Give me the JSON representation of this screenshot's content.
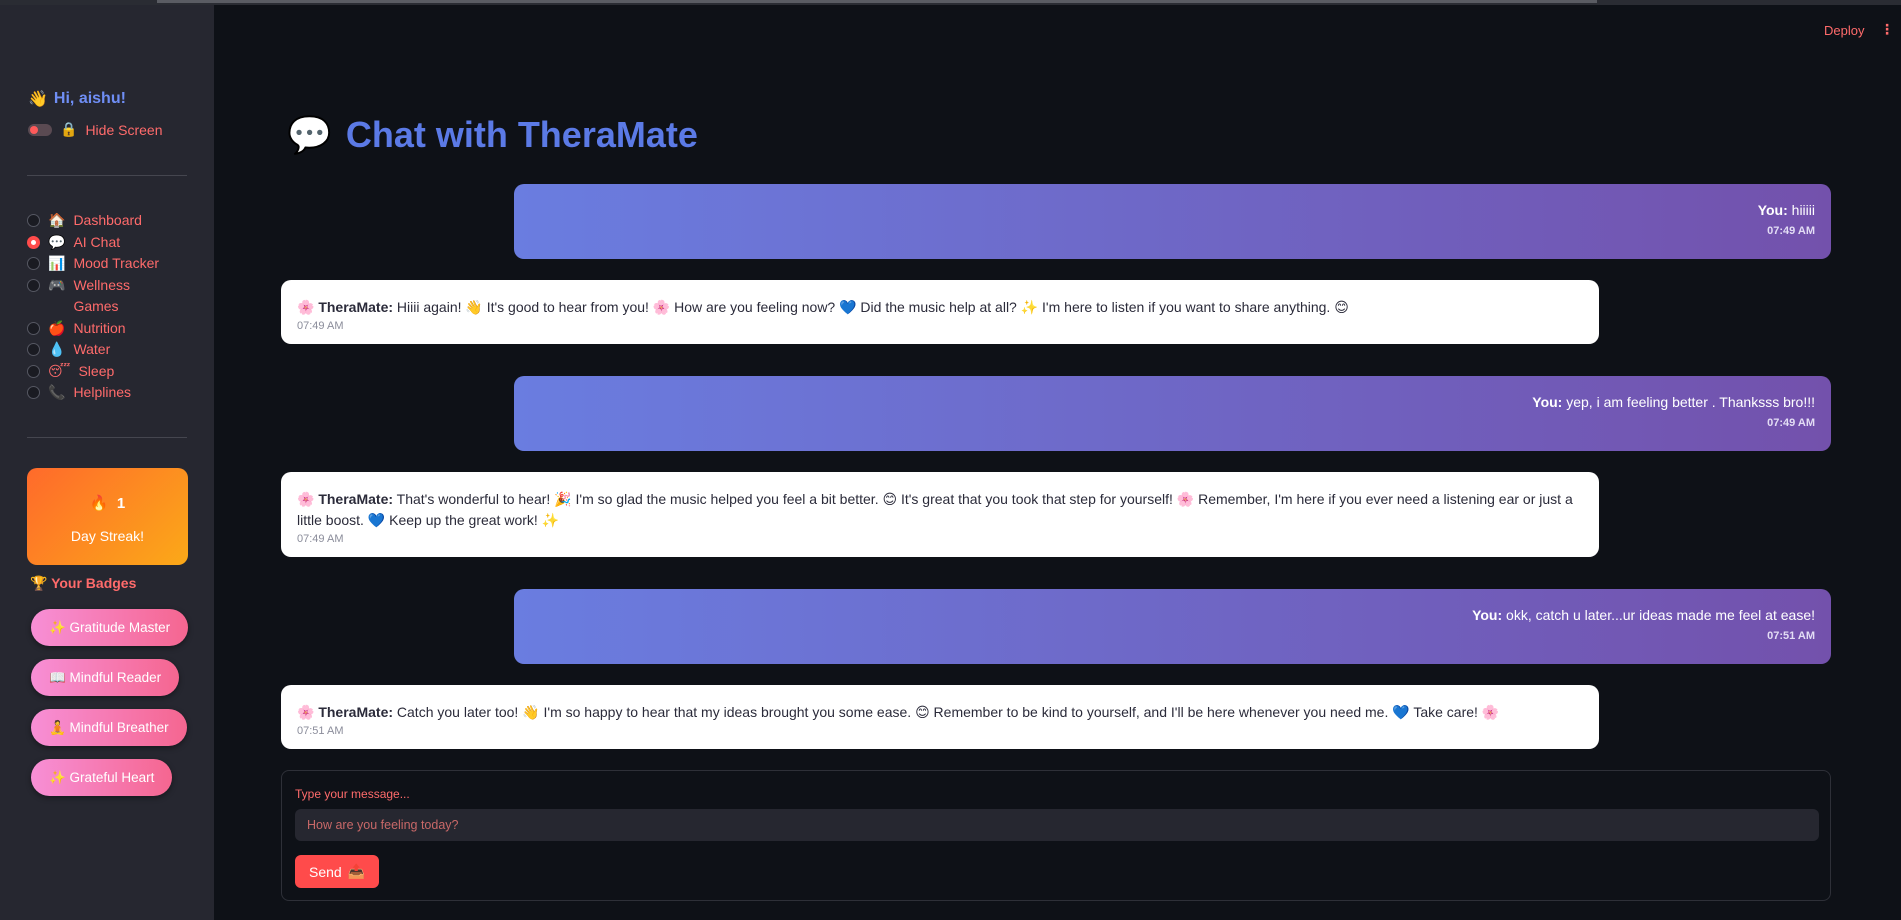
{
  "header": {
    "deploy_label": "Deploy",
    "menu_glyph": "⋮"
  },
  "sidebar": {
    "greeting_icon": "👋",
    "greeting": "Hi, aishu!",
    "hide_screen_icon": "🔒",
    "hide_screen_label": "Hide Screen",
    "nav": [
      {
        "icon": "🏠",
        "label": "Dashboard",
        "selected": false
      },
      {
        "icon": "💬",
        "label": "AI Chat",
        "selected": true
      },
      {
        "icon": "📊",
        "label": "Mood Tracker",
        "selected": false
      },
      {
        "icon": "🎮",
        "label": "Wellness Games",
        "selected": false
      },
      {
        "icon": "🍎",
        "label": "Nutrition",
        "selected": false
      },
      {
        "icon": "💧",
        "label": "Water",
        "selected": false
      },
      {
        "icon": "😴",
        "label": "Sleep",
        "selected": false
      },
      {
        "icon": "📞",
        "label": "Helplines",
        "selected": false
      }
    ],
    "streak": {
      "icon": "🔥",
      "count": "1",
      "label": "Day Streak!"
    },
    "badges_title": "🏆 Your Badges",
    "badges": [
      "✨ Gratitude Master",
      "📖 Mindful Reader",
      "🧘 Mindful Breather",
      "✨ Grateful Heart"
    ]
  },
  "main": {
    "title_icon": "💬",
    "title": "Chat with TheraMate",
    "messages": [
      {
        "role": "user",
        "speaker": "You:",
        "text": " hiiiii",
        "time": "07:49 AM"
      },
      {
        "role": "bot",
        "speaker": "TheraMate:",
        "text": " Hiiii again! 👋 It's good to hear from you! 🌸 How are you feeling now? 💙 Did the music help at all? ✨ I'm here to listen if you want to share anything. 😊",
        "time": "07:49 AM"
      },
      {
        "role": "user",
        "speaker": "You:",
        "text": " yep, i am feeling better . Thanksss bro!!!",
        "time": "07:49 AM"
      },
      {
        "role": "bot",
        "speaker": "TheraMate:",
        "text": " That's wonderful to hear! 🎉 I'm so glad the music helped you feel a bit better. 😊 It's great that you took that step for yourself! 🌸 Remember, I'm here if you ever need a listening ear or just a little boost. 💙 Keep up the great work! ✨",
        "time": "07:49 AM"
      },
      {
        "role": "user",
        "speaker": "You:",
        "text": " okk, catch u later...ur ideas made me feel at ease!",
        "time": "07:51 AM"
      },
      {
        "role": "bot",
        "speaker": "TheraMate:",
        "text": " Catch you later too! 👋 I'm so happy to hear that my ideas brought you some ease. 😊 Remember to be kind to yourself, and I'll be here whenever you need me. 💙 Take care! 🌸",
        "time": "07:51 AM"
      }
    ],
    "bot_icon": "🌸",
    "input": {
      "label": "Type your message...",
      "placeholder": "How are you feeling today?",
      "value": "",
      "send_label": "Send",
      "send_icon": "📤"
    }
  }
}
